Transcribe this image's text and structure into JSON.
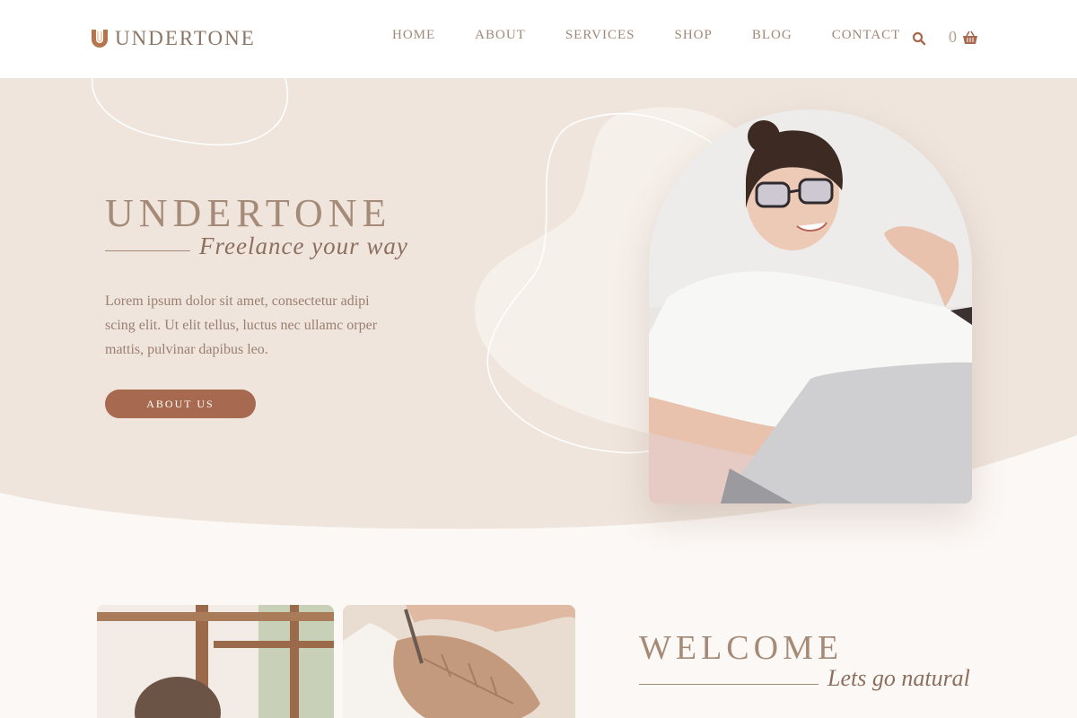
{
  "brand": {
    "name": "UNDERTONE",
    "logo_icon": "u-monogram-icon",
    "accent": "#b5764f"
  },
  "nav": {
    "items": [
      {
        "label": "HOME"
      },
      {
        "label": "ABOUT"
      },
      {
        "label": "SERVICES"
      },
      {
        "label": "SHOP"
      },
      {
        "label": "BLOG"
      },
      {
        "label": "CONTACT"
      }
    ],
    "search_icon": "search-icon",
    "cart_count": "0",
    "cart_icon": "basket-icon"
  },
  "hero": {
    "title": "UNDERTONE",
    "subtitle": "Freelance your way",
    "description": "Lorem ipsum dolor sit amet, consectetur adipi scing elit. Ut elit tellus, luctus nec ullamc orper mattis, pulvinar dapibus leo.",
    "button_label": "ABOUT US"
  },
  "welcome": {
    "title": "WELCOME",
    "subtitle": "Lets go natural"
  },
  "colors": {
    "hero_bg": "#efe5dd",
    "page_bg": "#fcf8f5",
    "button": "#a7694f",
    "heading": "#a58b77"
  }
}
